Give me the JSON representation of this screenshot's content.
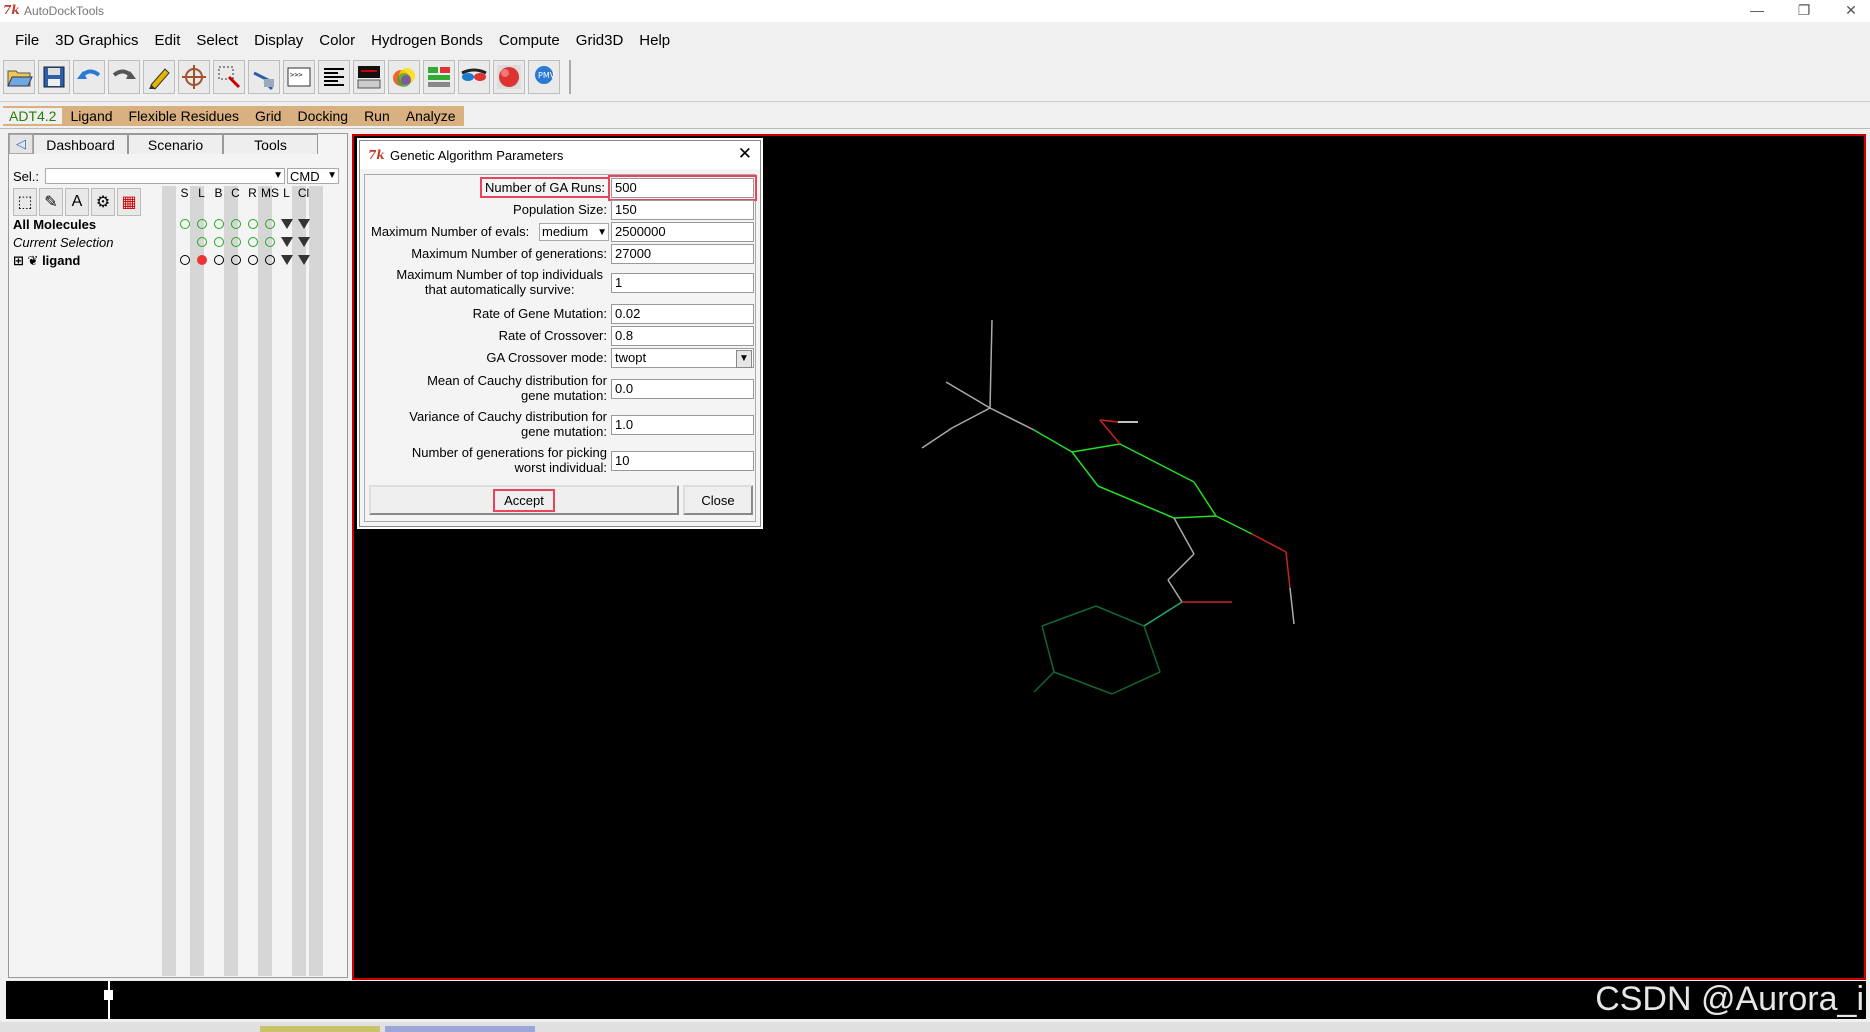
{
  "window": {
    "title": "AutoDockTools",
    "minimize": "—",
    "restore": "❐",
    "close": "✕"
  },
  "menubar": [
    "File",
    "3D Graphics",
    "Edit",
    "Select",
    "Display",
    "Color",
    "Hydrogen Bonds",
    "Compute",
    "Grid3D",
    "Help"
  ],
  "toolbar_icons": [
    "open-folder-icon",
    "save-disk-icon",
    "undo-icon",
    "redo-icon",
    "pencil-icon",
    "crosshair-icon",
    "selection-icon",
    "hand-pick-icon",
    "python-shell-icon",
    "text-align-icon",
    "monitor-icon",
    "color-sphere-icon",
    "gui-layout-icon",
    "stereo-glasses-icon",
    "surface-icon",
    "pmv-logo-icon"
  ],
  "adt_tabs": [
    "ADT4.2",
    "Ligand",
    "Flexible Residues",
    "Grid",
    "Docking",
    "Run",
    "Analyze"
  ],
  "left_panel": {
    "tabs": [
      "Dashboard",
      "Scenario",
      "Tools"
    ],
    "sel_label": "Sel.:",
    "cmd_label": "CMD",
    "column_headers": [
      "S",
      "L",
      "B",
      "C",
      "R",
      "MS",
      "L",
      "Cl"
    ],
    "rows": [
      "All Molecules",
      "Current Selection",
      "ligand"
    ],
    "expand_symbol": "⊞"
  },
  "dialog": {
    "title": "Genetic Algorithm Parameters",
    "params": [
      {
        "label": "Number of GA Runs:",
        "value": "500"
      },
      {
        "label": "Population Size:",
        "value": "150"
      },
      {
        "label": "Maximum Number of evals:",
        "value": "2500000",
        "select": "medium"
      },
      {
        "label": "Maximum Number of generations:",
        "value": "27000"
      },
      {
        "label": "Maximum Number of top individuals\nthat automatically survive:",
        "value": "1"
      },
      {
        "label": "Rate of Gene Mutation:",
        "value": "0.02"
      },
      {
        "label": "Rate of Crossover:",
        "value": "0.8"
      },
      {
        "label": "GA Crossover mode:",
        "value": "twopt"
      },
      {
        "label": "Mean of Cauchy distribution for\ngene mutation:",
        "value": "0.0"
      },
      {
        "label": "Variance of Cauchy distribution for\ngene mutation:",
        "value": "1.0"
      },
      {
        "label": "Number of generations for picking\nworst individual:",
        "value": "10"
      }
    ],
    "accept_label": "Accept",
    "close_label": "Close",
    "highlight_color": "#e8455a"
  },
  "watermark": "CSDN @Aurora_i",
  "colors": {
    "viewer_bg": "#000000",
    "viewer_border": "#cc0000",
    "adt_bar": "#d9b07f",
    "adt_active_text": "#2b7a0b"
  }
}
